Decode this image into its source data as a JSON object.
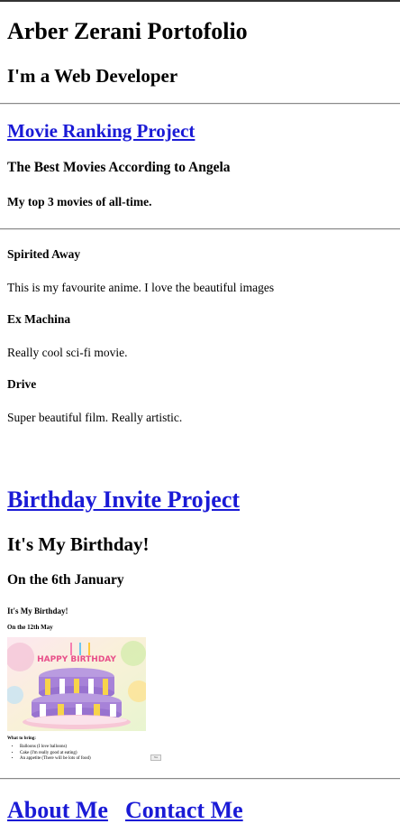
{
  "header": {
    "title": "Arber Zerani Portofolio",
    "subtitle": "I'm a Web Developer"
  },
  "movie_project": {
    "link_label": "Movie Ranking Project",
    "heading": "The Best Movies According to Angela",
    "subheading": "My top 3 movies of all-time.",
    "movies": [
      {
        "title": "Spirited Away",
        "description": "This is my favourite anime. I love the beautiful images"
      },
      {
        "title": "Ex Machina",
        "description": "Really cool sci-fi movie."
      },
      {
        "title": "Drive",
        "description": "Super beautiful film. Really artistic."
      }
    ]
  },
  "birthday_project": {
    "link_label": "Birthday Invite Project",
    "heading": "It's My Birthday!",
    "date": "On the 6th January",
    "embed": {
      "heading": "It's My Birthday!",
      "date": "On the 12th May",
      "image_text": "HAPPY BIRTHDAY",
      "bring_label": "What to bring:",
      "items": [
        "Balloons (I love balloons)",
        "Cake (I'm really good at eating)",
        "An appetite (There will be lots of food)"
      ],
      "button_label": "Yes"
    }
  },
  "footer": {
    "about_label": "About Me",
    "contact_label": "Contact Me"
  },
  "colors": {
    "link": "#1a1ad6",
    "text": "#000000",
    "rule": "#8a8a8a"
  }
}
